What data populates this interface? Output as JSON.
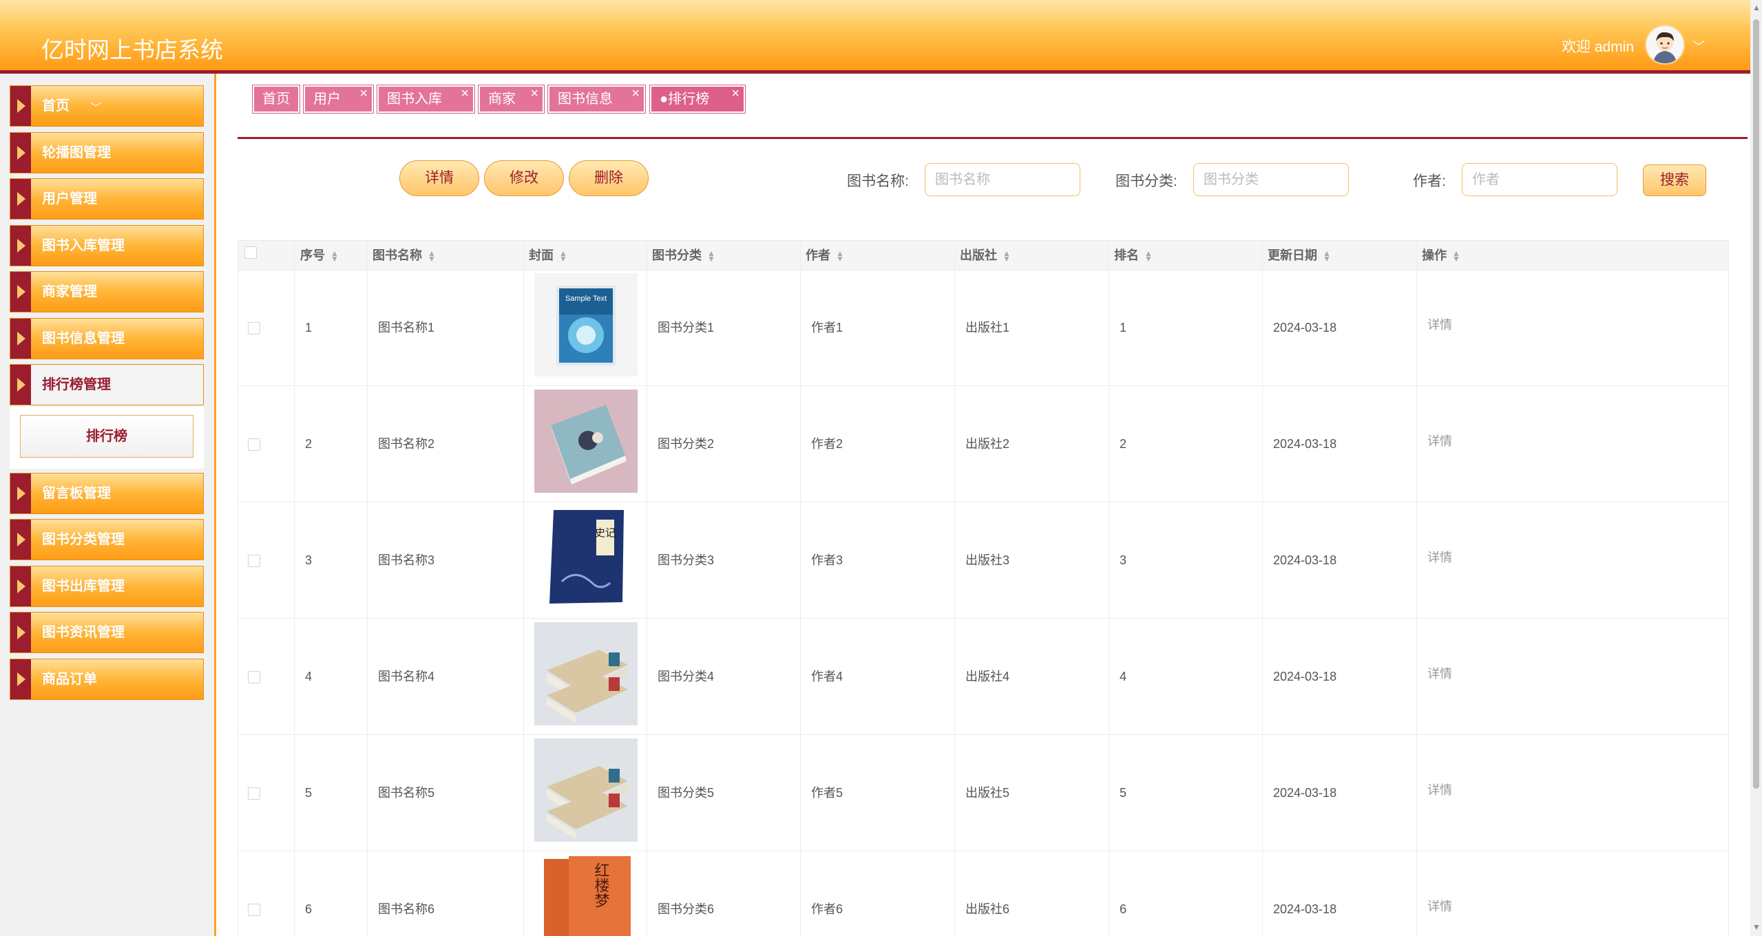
{
  "header": {
    "title": "亿时网上书店系统",
    "welcome": "欢迎 admin"
  },
  "sidebar": {
    "items": [
      {
        "label": "首页"
      },
      {
        "label": "轮播图管理"
      },
      {
        "label": "用户管理"
      },
      {
        "label": "图书入库管理"
      },
      {
        "label": "商家管理"
      },
      {
        "label": "图书信息管理"
      },
      {
        "label": "排行榜管理"
      },
      {
        "label": "留言板管理"
      },
      {
        "label": "图书分类管理"
      },
      {
        "label": "图书出库管理"
      },
      {
        "label": "图书资讯管理"
      },
      {
        "label": "商品订单"
      }
    ],
    "active_sub": "排行榜"
  },
  "tabs": [
    {
      "label": "首页"
    },
    {
      "label": "用户"
    },
    {
      "label": "图书入库"
    },
    {
      "label": "商家"
    },
    {
      "label": "图书信息"
    },
    {
      "label": "●排行榜"
    }
  ],
  "toolbar": {
    "detail": "详情",
    "edit": "修改",
    "delete": "删除",
    "search": "搜索"
  },
  "search": {
    "name_label": "图书名称:",
    "name_placeholder": "图书名称",
    "category_label": "图书分类:",
    "category_placeholder": "图书分类",
    "author_label": "作者:",
    "author_placeholder": "作者"
  },
  "table": {
    "headers": [
      "序号",
      "图书名称",
      "封面",
      "图书分类",
      "作者",
      "出版社",
      "排名",
      "更新日期",
      "操作"
    ],
    "rows": [
      {
        "no": "1",
        "name": "图书名称1",
        "category": "图书分类1",
        "author": "作者1",
        "publisher": "出版社1",
        "rank": "1",
        "date": "2024-03-18",
        "op": "详情"
      },
      {
        "no": "2",
        "name": "图书名称2",
        "category": "图书分类2",
        "author": "作者2",
        "publisher": "出版社2",
        "rank": "2",
        "date": "2024-03-18",
        "op": "详情"
      },
      {
        "no": "3",
        "name": "图书名称3",
        "category": "图书分类3",
        "author": "作者3",
        "publisher": "出版社3",
        "rank": "3",
        "date": "2024-03-18",
        "op": "详情"
      },
      {
        "no": "4",
        "name": "图书名称4",
        "category": "图书分类4",
        "author": "作者4",
        "publisher": "出版社4",
        "rank": "4",
        "date": "2024-03-18",
        "op": "详情"
      },
      {
        "no": "5",
        "name": "图书名称5",
        "category": "图书分类5",
        "author": "作者5",
        "publisher": "出版社5",
        "rank": "5",
        "date": "2024-03-18",
        "op": "详情"
      },
      {
        "no": "6",
        "name": "图书名称6",
        "category": "图书分类6",
        "author": "作者6",
        "publisher": "出版社6",
        "rank": "6",
        "date": "2024-03-18",
        "op": "详情"
      }
    ],
    "covers": [
      {
        "title": "Sample Text",
        "palette": "blue"
      },
      {
        "title": "",
        "palette": "teal"
      },
      {
        "title": "史记",
        "palette": "navy"
      },
      {
        "title": "",
        "palette": "tan"
      },
      {
        "title": "",
        "palette": "tan"
      },
      {
        "title": "红楼梦",
        "palette": "orange"
      }
    ]
  },
  "colors": {
    "brand_maroon": "#9b1d2e",
    "header_orange": "#ff9a13",
    "tab_pink": "#e4739a"
  }
}
